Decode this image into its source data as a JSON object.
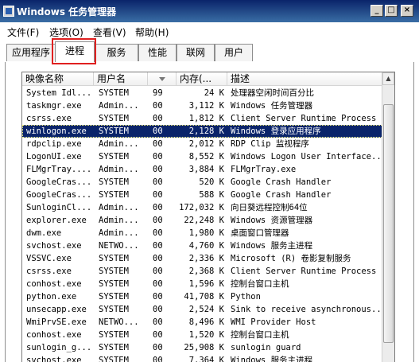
{
  "window": {
    "title": "Windows 任务管理器",
    "minimize_glyph": "_",
    "maximize_glyph": "□",
    "close_glyph": "×"
  },
  "menu": [
    "文件(F)",
    "选项(O)",
    "查看(V)",
    "帮助(H)"
  ],
  "tabs": [
    "应用程序",
    "进程",
    "服务",
    "性能",
    "联网",
    "用户"
  ],
  "active_tab": "进程",
  "columns": {
    "name": "映像名称",
    "user": "用户名",
    "cpu": "",
    "mem": "内存(...",
    "desc": "描述"
  },
  "processes": [
    {
      "name": "System Idl...",
      "user": "SYSTEM",
      "cpu": "99",
      "mem": "24 K",
      "desc": "处理器空闲时间百分比"
    },
    {
      "name": "taskmgr.exe",
      "user": "Admin...",
      "cpu": "00",
      "mem": "3,112 K",
      "desc": "Windows 任务管理器"
    },
    {
      "name": "csrss.exe",
      "user": "SYSTEM",
      "cpu": "00",
      "mem": "1,812 K",
      "desc": "Client Server Runtime Process"
    },
    {
      "name": "winlogon.exe",
      "user": "SYSTEM",
      "cpu": "00",
      "mem": "2,128 K",
      "desc": "Windows 登录应用程序",
      "selected": true
    },
    {
      "name": "rdpclip.exe",
      "user": "Admin...",
      "cpu": "00",
      "mem": "2,012 K",
      "desc": "RDP Clip 监视程序"
    },
    {
      "name": "LogonUI.exe",
      "user": "SYSTEM",
      "cpu": "00",
      "mem": "8,552 K",
      "desc": "Windows Logon User Interface..."
    },
    {
      "name": "FLMgrTray....",
      "user": "Admin...",
      "cpu": "00",
      "mem": "3,884 K",
      "desc": "FLMgrTray.exe"
    },
    {
      "name": "GoogleCras...",
      "user": "SYSTEM",
      "cpu": "00",
      "mem": "520 K",
      "desc": "Google Crash Handler"
    },
    {
      "name": "GoogleCras...",
      "user": "SYSTEM",
      "cpu": "00",
      "mem": "588 K",
      "desc": "Google Crash Handler"
    },
    {
      "name": "SunloginCl...",
      "user": "Admin...",
      "cpu": "00",
      "mem": "172,032 K",
      "desc": "向日葵远程控制64位"
    },
    {
      "name": "explorer.exe",
      "user": "Admin...",
      "cpu": "00",
      "mem": "22,248 K",
      "desc": "Windows 资源管理器"
    },
    {
      "name": "dwm.exe",
      "user": "Admin...",
      "cpu": "00",
      "mem": "1,980 K",
      "desc": "桌面窗口管理器"
    },
    {
      "name": "svchost.exe",
      "user": "NETWO...",
      "cpu": "00",
      "mem": "4,760 K",
      "desc": "Windows 服务主进程"
    },
    {
      "name": "VSSVC.exe",
      "user": "SYSTEM",
      "cpu": "00",
      "mem": "2,336 K",
      "desc": "Microsoft (R) 卷影复制服务"
    },
    {
      "name": "csrss.exe",
      "user": "SYSTEM",
      "cpu": "00",
      "mem": "2,368 K",
      "desc": "Client Server Runtime Process"
    },
    {
      "name": "conhost.exe",
      "user": "SYSTEM",
      "cpu": "00",
      "mem": "1,596 K",
      "desc": "控制台窗口主机"
    },
    {
      "name": "python.exe",
      "user": "SYSTEM",
      "cpu": "00",
      "mem": "41,708 K",
      "desc": "Python"
    },
    {
      "name": "unsecapp.exe",
      "user": "SYSTEM",
      "cpu": "00",
      "mem": "2,524 K",
      "desc": "Sink to receive asynchronous..."
    },
    {
      "name": "WmiPrvSE.exe",
      "user": "NETWO...",
      "cpu": "00",
      "mem": "8,496 K",
      "desc": "WMI Provider Host"
    },
    {
      "name": "conhost.exe",
      "user": "SYSTEM",
      "cpu": "00",
      "mem": "1,520 K",
      "desc": "控制台窗口主机"
    },
    {
      "name": "sunlogin_g...",
      "user": "SYSTEM",
      "cpu": "00",
      "mem": "25,908 K",
      "desc": "sunlogin guard"
    },
    {
      "name": "svchost.exe",
      "user": "SYSTEM",
      "cpu": "00",
      "mem": "7,364 K",
      "desc": "Windows 服务主进程"
    }
  ],
  "scrollbar": {
    "up_glyph": "▲"
  }
}
